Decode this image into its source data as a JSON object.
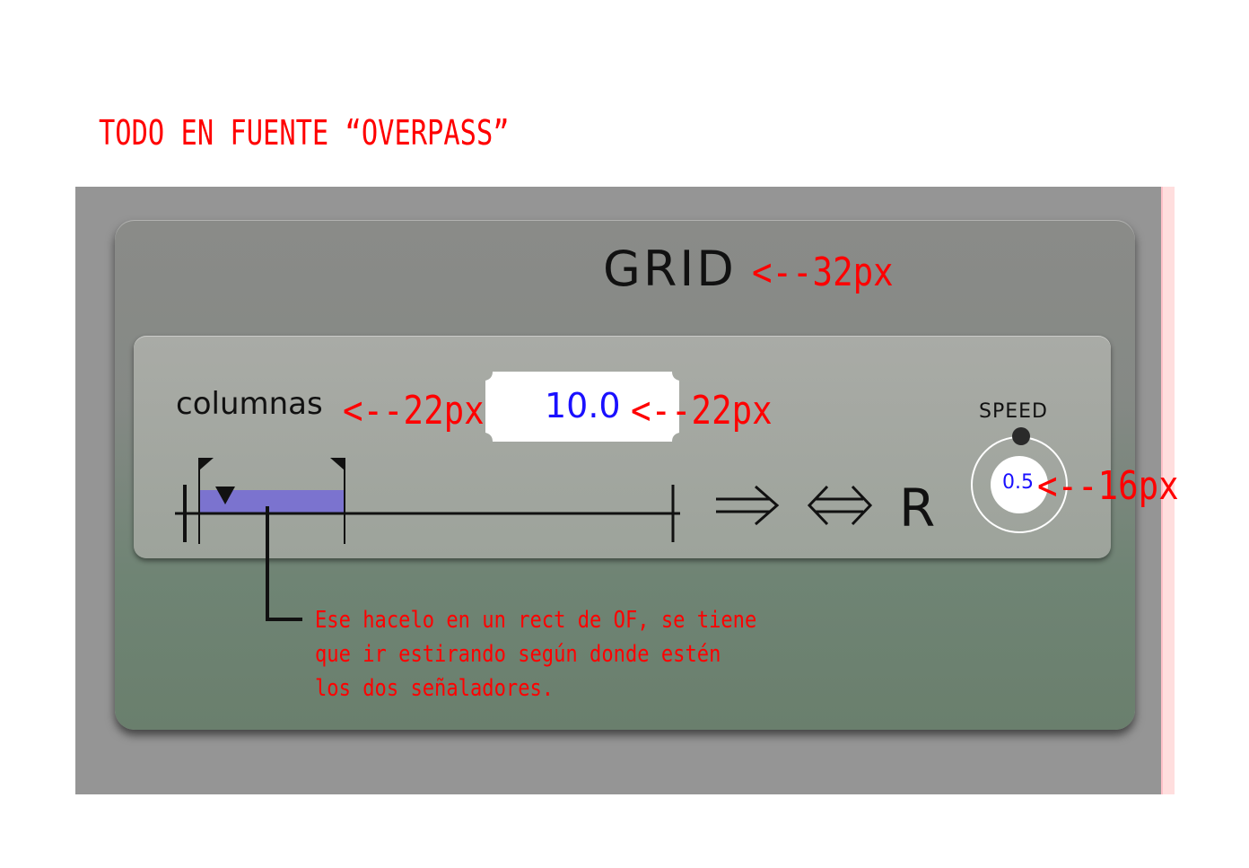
{
  "top_note": "TODO EN FUENTE “OVERPASS”",
  "panel": {
    "title": "GRID",
    "columns_label": "columnas",
    "columns_value": "10.0",
    "speed_label": "SPEED",
    "speed_value": "0.5",
    "reset_label": "R"
  },
  "annotations": {
    "title_size": "<--32px",
    "label_size": "<--22px",
    "value_size": "<--22px",
    "speed_size": "<--16px",
    "range_note": "Ese hacelo en un rect de OF, se tiene\nque ir estirando según donde estén\nlos dos señaladores."
  },
  "range": {
    "start": 0.0,
    "end": 0.29,
    "playhead": 0.08
  },
  "icons": [
    "arrow-right-icon",
    "arrow-left-right-icon",
    "reset-icon"
  ],
  "colors": {
    "accent_value": "#1a10ff",
    "range_fill": "#7b73cf",
    "annotation": "#ff0000"
  }
}
